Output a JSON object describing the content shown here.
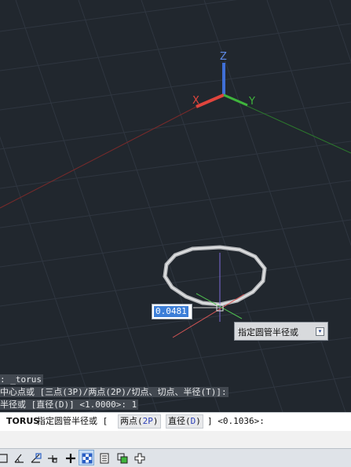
{
  "dynamic_input": {
    "value": "0.0481"
  },
  "tooltip": {
    "text": "指定圆管半径或",
    "arrow": "▾"
  },
  "axis_labels": {
    "x": "X",
    "y": "Y",
    "z": "Z"
  },
  "history": {
    "line1": ": _torus",
    "line2": "中心点或 [三点(3P)/两点(2P)/切点、切点、半径(T)]:",
    "line3": "半径或 [直径(D)] <1.0000>: 1"
  },
  "command_line": {
    "command": "TORUS",
    "prompt": "指定圆管半径或 [",
    "opt1_label": "两点(",
    "opt1_key": "2P",
    "opt1_close": ")",
    "opt2_label": "直径(",
    "opt2_key": "D",
    "opt2_close": ")",
    "suffix": "] <0.1036>:"
  },
  "status_bar": {
    "buttons": [
      "ortho-icon",
      "polar-icon",
      "osnap-icon",
      "otrack-icon",
      "lineweight-icon",
      "transparency-icon",
      "quickprops-icon",
      "selection-cycling-icon",
      "dynamic-ucs-icon"
    ]
  },
  "colors": {
    "viewport_bg": "#21272e",
    "x_axis": "#e0453d",
    "y_axis": "#3fb43c",
    "z_axis": "#3f6fd6",
    "input_highlight": "#3d7fd8"
  }
}
